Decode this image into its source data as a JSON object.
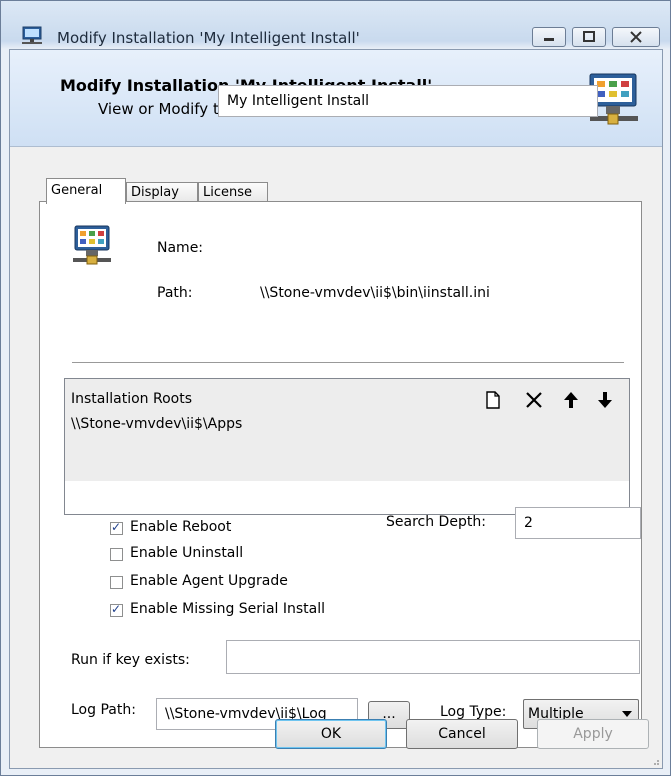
{
  "window": {
    "title": "Modify Installation 'My Intelligent Install'"
  },
  "banner": {
    "title": "Modify Installation 'My Intelligent Install'",
    "subtitle": "View or Modify this Intelligent Install installation"
  },
  "tabs": [
    {
      "label": "General"
    },
    {
      "label": "Display"
    },
    {
      "label": "License"
    }
  ],
  "general": {
    "name_label": "Name:",
    "name_value": "My Intelligent Install",
    "path_label": "Path:",
    "path_value": "\\\\Stone-vmvdev\\ii$\\bin\\iinstall.ini",
    "roots": {
      "header": "Installation Roots",
      "items": [
        "\\\\Stone-vmvdev\\ii$\\Apps"
      ]
    },
    "options": [
      {
        "label": "Enable Reboot",
        "checked": true
      },
      {
        "label": "Enable Uninstall",
        "checked": false
      },
      {
        "label": "Enable Agent Upgrade",
        "checked": false
      },
      {
        "label": "Enable Missing Serial Install",
        "checked": true
      }
    ],
    "search_depth_label": "Search Depth:",
    "search_depth_value": "2",
    "run_if_key_label": "Run if key exists:",
    "run_if_key_value": "",
    "log_path_label": "Log Path:",
    "log_path_value": "\\\\Stone-vmvdev\\ii$\\Log",
    "browse_label": "...",
    "log_type_label": "Log Type:",
    "log_type_value": "Multiple"
  },
  "buttons": {
    "ok": "OK",
    "cancel": "Cancel",
    "apply": "Apply"
  }
}
